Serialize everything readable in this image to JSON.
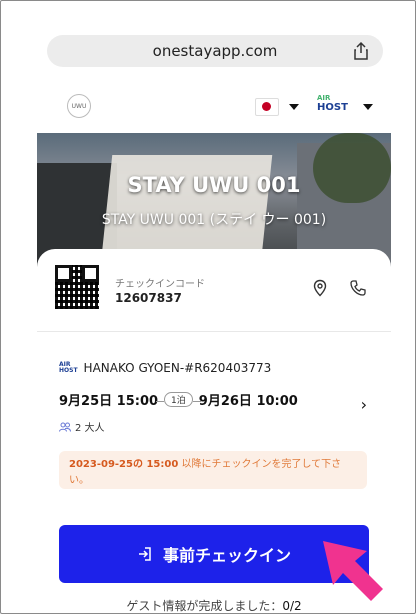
{
  "browser": {
    "url": "onestayapp.com"
  },
  "header": {
    "flag": "jp-flag-icon",
    "partner": {
      "top": "AIR",
      "bottom": "HOST"
    }
  },
  "hero": {
    "title": "STAY UWU 001",
    "subtitle": "STAY UWU 001 (ステイ ウー 001)"
  },
  "checkin_code": {
    "label": "チェックインコード",
    "value": "12607837"
  },
  "reservation": {
    "source": "HANAKO GYOEN-#R620403773",
    "checkin": "9月25日 15:00",
    "nights": "1泊",
    "checkout": "9月26日 10:00",
    "guests": "2 大人"
  },
  "notice": {
    "datetime": "2023-09-25の 15:00",
    "text": " 以降にチェックインを完了して下さい。"
  },
  "cta": {
    "label": "事前チェックイン"
  },
  "guest_info": {
    "label": "ゲスト情報が完成しました：",
    "count": "0/2"
  },
  "colors": {
    "primary": "#1d22ea",
    "notice_bg": "#fcefe6",
    "notice_text": "#e07a3a",
    "annotation_arrow": "#f0338f"
  }
}
